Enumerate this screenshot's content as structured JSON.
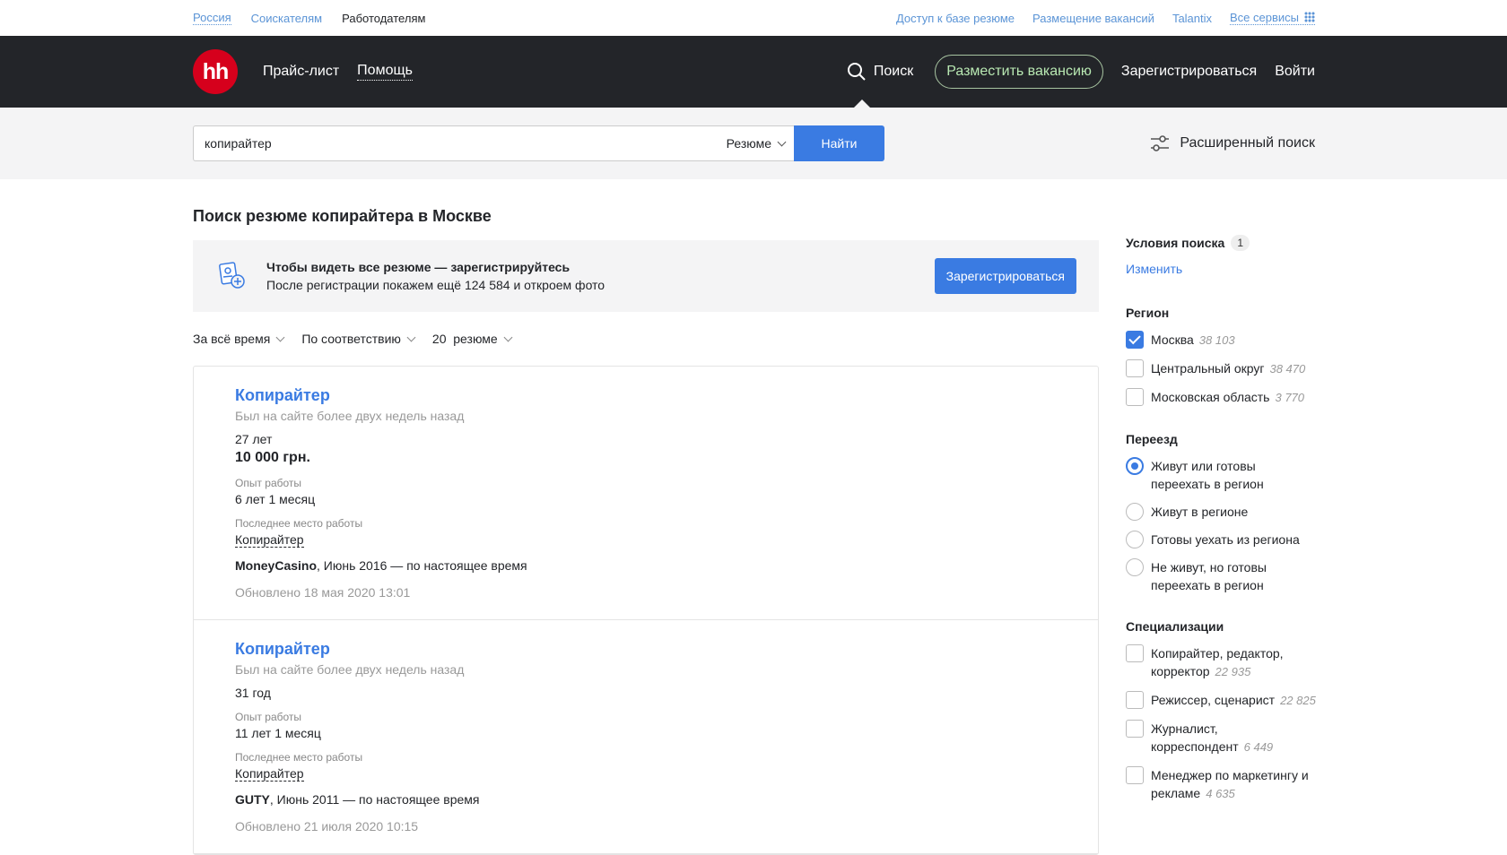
{
  "topbar": {
    "region": "Россия",
    "seekers": "Соискателям",
    "employers": "Работодателям",
    "links": [
      "Доступ к базе резюме",
      "Размещение вакансий",
      "Talantix"
    ],
    "all_services": "Все сервисы"
  },
  "header": {
    "logo": "hh",
    "price_list": "Прайс-лист",
    "help": "Помощь",
    "search": "Поиск",
    "post_vacancy": "Разместить вакансию",
    "register": "Зарегистрироваться",
    "login": "Войти"
  },
  "search": {
    "query": "копирайтер",
    "type": "Резюме",
    "submit": "Найти",
    "advanced": "Расширенный поиск"
  },
  "main": {
    "title": "Поиск резюме копирайтера в Москве",
    "banner": {
      "headline": "Чтобы видеть все резюме — зарегистрируйтесь",
      "subtext": "После регистрации покажем ещё 124 584 и откроем фото",
      "button": "Зарегистрироваться"
    },
    "filters": {
      "period": "За всё время",
      "sort": "По соответствию",
      "per_page": "20  резюме"
    },
    "results": [
      {
        "title": "Копирайтер",
        "last_seen": "Был на сайте более двух недель назад",
        "age": "27 лет",
        "salary": "10 000 грн.",
        "experience_label": "Опыт работы",
        "experience": "6 лет 1 месяц",
        "last_job_label": "Последнее место работы",
        "last_position": "Копирайтер",
        "company": "MoneyCasino",
        "period": ", Июнь 2016 — по настоящее время",
        "updated": "Обновлено 18 мая 2020 13:01"
      },
      {
        "title": "Копирайтер",
        "last_seen": "Был на сайте более двух недель назад",
        "age": "31 год",
        "experience_label": "Опыт работы",
        "experience": "11 лет 1 месяц",
        "last_job_label": "Последнее место работы",
        "last_position": "Копирайтер",
        "company": "GUTY",
        "period": ", Июнь 2011 — по настоящее время",
        "updated": "Обновлено 21 июля 2020 10:15"
      }
    ]
  },
  "sidebar": {
    "conditions": "Условия поиска",
    "conditions_count": "1",
    "change": "Изменить",
    "region": {
      "title": "Регион",
      "options": [
        {
          "label": "Москва",
          "count": "38 103",
          "checked": true
        },
        {
          "label": "Центральный округ",
          "count": "38 470",
          "checked": false
        },
        {
          "label": "Московская область",
          "count": "3 770",
          "checked": false
        }
      ]
    },
    "relocation": {
      "title": "Переезд",
      "options": [
        {
          "label": "Живут или готовы переехать в регион",
          "checked": true
        },
        {
          "label": "Живут в регионе",
          "checked": false
        },
        {
          "label": "Готовы уехать из региона",
          "checked": false
        },
        {
          "label": "Не живут, но готовы переехать в регион",
          "checked": false
        }
      ]
    },
    "specializations": {
      "title": "Специализации",
      "options": [
        {
          "label": "Копирайтер, редактор, корректор",
          "count": "22 935"
        },
        {
          "label": "Режиссер, сценарист",
          "count": "22 825"
        },
        {
          "label": "Журналист, корреспондент",
          "count": "6 449"
        },
        {
          "label": "Менеджер по маркетингу и рекламе",
          "count": "4 635"
        }
      ]
    }
  },
  "colors": {
    "brand_red": "#d6001c",
    "link_blue": "#3a7be2",
    "header_bg": "#232529"
  }
}
